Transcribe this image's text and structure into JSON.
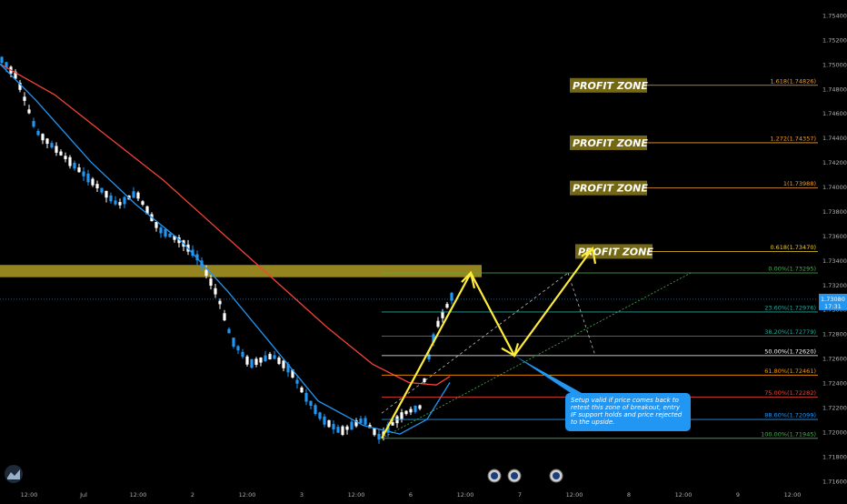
{
  "chart_data": {
    "type": "candlestick",
    "title": "",
    "y_axis": {
      "ticks": [
        "1.75400",
        "1.75200",
        "1.75000",
        "1.74800",
        "1.74600",
        "1.74400",
        "1.74200",
        "1.74000",
        "1.73800",
        "1.73600",
        "1.73400",
        "1.73200",
        "1.73000",
        "1.72800",
        "1.72600",
        "1.72400",
        "1.72200",
        "1.72000",
        "1.71800",
        "1.71600"
      ],
      "range": [
        1.7155,
        1.755
      ],
      "last_price": "1.73080",
      "countdown": "17:31"
    },
    "x_axis": {
      "ticks": [
        "12:00",
        "Jul",
        "12:00",
        "2",
        "12:00",
        "3",
        "12:00",
        "6",
        "12:00",
        "7",
        "12:00",
        "8",
        "12:00",
        "9",
        "12:00"
      ]
    },
    "fib_levels": [
      {
        "label": "1.618(1.74826)",
        "price": 1.74826,
        "color": "#f0a030",
        "zone_label": "PROFIT ZONE"
      },
      {
        "label": "1.272(1.74357)",
        "price": 1.74357,
        "color": "#f0a030",
        "zone_label": "PROFIT ZONE"
      },
      {
        "label": "1(1.73988)",
        "price": 1.73988,
        "color": "#f0a030",
        "zone_label": "PROFIT ZONE"
      },
      {
        "label": "0.618(1.73470)",
        "price": 1.7347,
        "color": "#f0d020",
        "zone_label": "PROFIT ZONE"
      },
      {
        "label": "0.00%(1.73295)",
        "price": 1.73295,
        "color": "#4caf50"
      },
      {
        "label": "23.60%(1.72976)",
        "price": 1.72976,
        "color": "#26a69a"
      },
      {
        "label": "38.20%(1.72779)",
        "price": 1.72779,
        "color": "#26a69a"
      },
      {
        "label": "50.00%(1.72620)",
        "price": 1.7262,
        "color": "#ffffff"
      },
      {
        "label": "61.80%(1.72461)",
        "price": 1.72461,
        "color": "#ff9800"
      },
      {
        "label": "75.00%(1.72282)",
        "price": 1.72282,
        "color": "#f44336"
      },
      {
        "label": "88.60%(1.72099)",
        "price": 1.72099,
        "color": "#2196f3"
      },
      {
        "label": "100.00%(1.71945)",
        "price": 1.71945,
        "color": "#4caf50"
      }
    ],
    "resistance_zone": [
      1.7326,
      1.7336
    ],
    "callout": "Setup valid if price comes back to retest this zone of breakout, entry IF support holds and price rejected to the upside.",
    "ema_fast_color": "#2196f3",
    "ema_slow_color": "#f44336",
    "up_color": "#2196f3",
    "down_color": "#ffffff"
  }
}
